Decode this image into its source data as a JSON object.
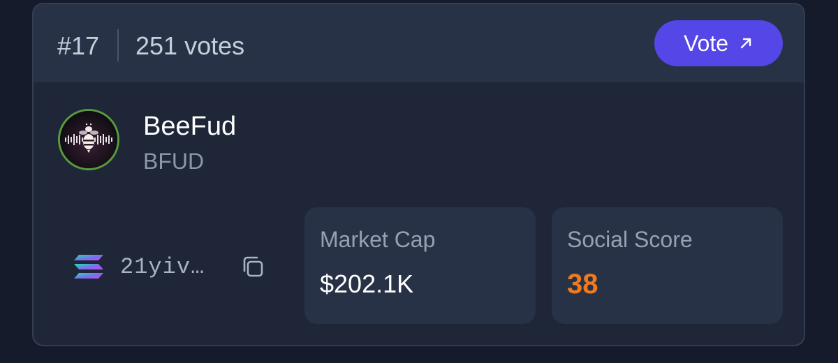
{
  "card": {
    "rank": "#17",
    "votes": "251 votes",
    "vote_button": {
      "label": "Vote",
      "icon": "arrow-up-right-icon",
      "color": "#5546e8"
    },
    "token": {
      "name": "BeeFud",
      "symbol": "BFUD",
      "avatar_icon": "bee-logo",
      "chain_icon": "solana-icon"
    },
    "address": "21yiv…",
    "copy_icon": "copy-icon",
    "stats": {
      "market_cap": {
        "label": "Market Cap",
        "value": "$202.1K"
      },
      "social_score": {
        "label": "Social Score",
        "value": "38",
        "color": "#f07a1e"
      }
    }
  }
}
